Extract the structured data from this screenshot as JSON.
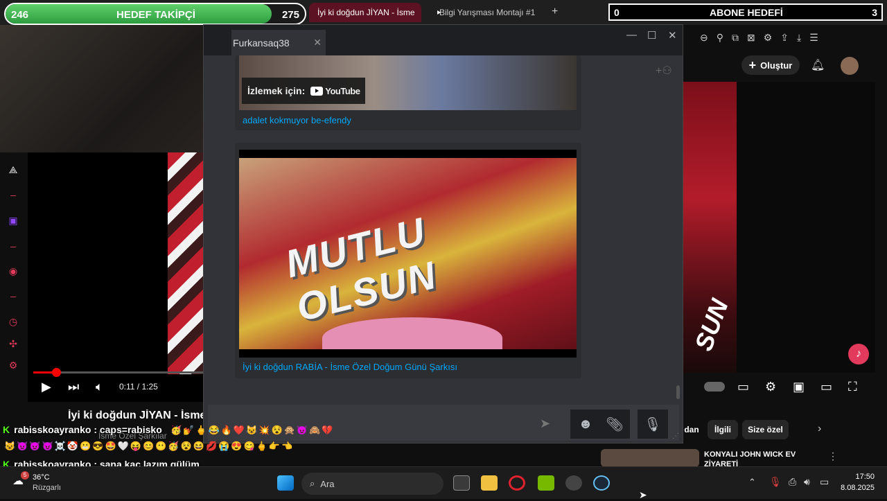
{
  "browser": {
    "tabs": [
      {
        "label": "İyi ki doğdun JİYAN - İsme",
        "active": true
      },
      {
        "label": "Bilgi Yarışması Montajı #1",
        "active": false
      }
    ],
    "new_tab": "+"
  },
  "overlay": {
    "follow_current": "246",
    "follow_label": "HEDEF TAKİPÇİ",
    "follow_goal": "275",
    "follow_progress": 0.89,
    "sub_current": "0",
    "sub_label": "ABONE HEDEFİ",
    "sub_goal": "3"
  },
  "youtube": {
    "create_label": "Oluştur",
    "player": {
      "time": "0:11 / 1:25",
      "progress": 0.13
    },
    "video_title": "İyi ki doğdun JİYAN - İsme",
    "channel_subtitle": "İsme Özel Şarkılar",
    "chips": [
      "dan",
      "İlgili",
      "Size özel"
    ],
    "recommended_title_1": "KONYALI JOHN WICK EV",
    "recommended_title_2": "ZİYARETİ"
  },
  "chat_window": {
    "tab_title": "Furkansaq38",
    "messages": [
      {
        "watch_label": "İzlemek için:",
        "yt_logo": "YouTube",
        "link": "adalet kokmuyor be-efendy"
      },
      {
        "art_text": "MUTLU OLSUN",
        "link": "İyi ki doğdun RABİA - İsme Özel Doğum Günü Şarkısı"
      }
    ]
  },
  "stream_chat": [
    {
      "user": "rabisskoayranko",
      "text": ": caps=rabisko"
    },
    {
      "user": "rabisskoayranko",
      "text": ": sana kaç lazım gülüm"
    }
  ],
  "emoji_rows": [
    "🥳💅🖕😂🔥❤️😺💥😵🙊😈🙈💔",
    "😺👿👿😈☠️🤡😬😎🤩🤍😝😊😶🥳😵😆💋😭😍😋🖕👉👈"
  ],
  "taskbar": {
    "weather_temp": "36°C",
    "weather_desc": "Rüzgarlı",
    "weather_badge": "5",
    "search_placeholder": "Ara",
    "time": "17:50",
    "date": "8.08.2025"
  }
}
